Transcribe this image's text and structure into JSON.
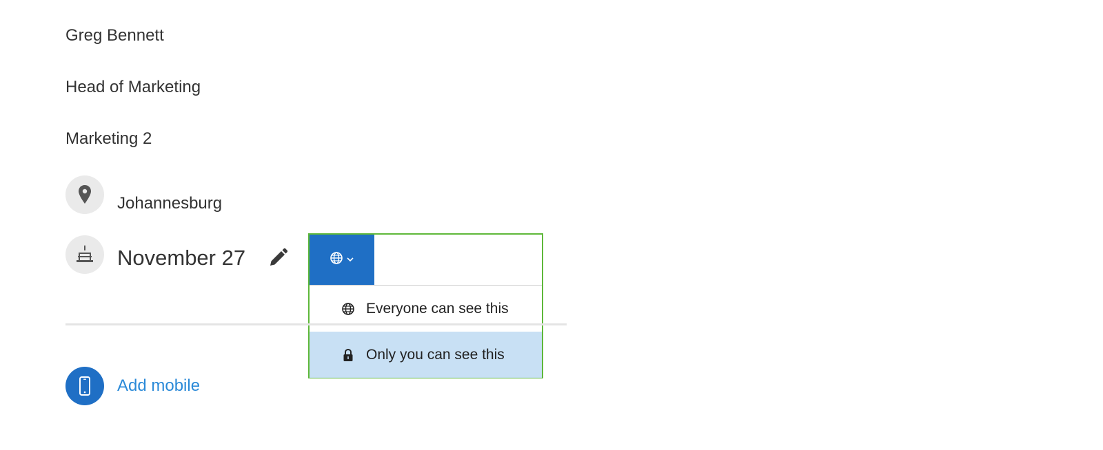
{
  "profile": {
    "name": "Greg Bennett",
    "job_title": "Head of Marketing",
    "department": "Marketing 2",
    "location": "Johannesburg",
    "birthday": "November 27"
  },
  "privacy_menu": {
    "selected_icon": "globe-icon",
    "options": [
      {
        "icon": "globe-icon",
        "label": "Everyone can see this"
      },
      {
        "icon": "lock-icon",
        "label": "Only you can see this"
      }
    ],
    "highlighted_index": 1
  },
  "contact": {
    "add_mobile_label": "Add mobile"
  },
  "colors": {
    "accent_blue": "#1f6fc5",
    "link_blue": "#2b8ad8",
    "focus_green": "#5fb83a",
    "highlight_row": "#c8e0f4",
    "icon_circle_gray": "#eaeaea"
  }
}
